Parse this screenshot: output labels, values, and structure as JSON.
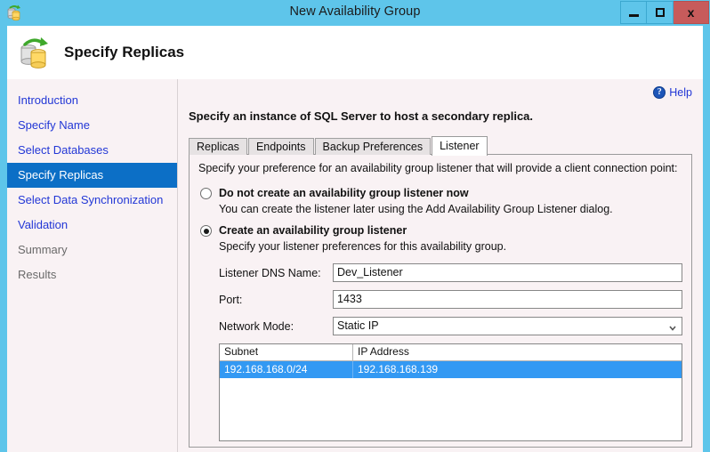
{
  "window": {
    "title": "New Availability Group",
    "icon": "database-sync-icon",
    "buttons": {
      "minimize": "minimize-button",
      "maximize": "maximize-button",
      "close": "x"
    }
  },
  "header": {
    "title": "Specify Replicas",
    "icon": "database-sync-icon"
  },
  "sidebar": {
    "items": [
      {
        "label": "Introduction",
        "state": "link"
      },
      {
        "label": "Specify Name",
        "state": "link"
      },
      {
        "label": "Select Databases",
        "state": "link"
      },
      {
        "label": "Specify Replicas",
        "state": "selected"
      },
      {
        "label": "Select Data Synchronization",
        "state": "link"
      },
      {
        "label": "Validation",
        "state": "link"
      },
      {
        "label": "Summary",
        "state": "disabled"
      },
      {
        "label": "Results",
        "state": "disabled"
      }
    ]
  },
  "content": {
    "help": {
      "label": "Help",
      "icon": "question-mark-icon"
    },
    "instruction": "Specify an instance of SQL Server to host a secondary replica.",
    "tabs": [
      {
        "label": "Replicas",
        "active": false
      },
      {
        "label": "Endpoints",
        "active": false
      },
      {
        "label": "Backup Preferences",
        "active": false
      },
      {
        "label": "Listener",
        "active": true
      }
    ],
    "panel": {
      "description": "Specify your preference for an availability group listener that will provide a client connection point:",
      "options": [
        {
          "label": "Do not create an availability group listener now",
          "sublabel": "You can create the listener later using the Add Availability Group Listener dialog.",
          "selected": false
        },
        {
          "label": "Create an availability group listener",
          "sublabel": "Specify your listener preferences for this availability group.",
          "selected": true
        }
      ],
      "form": {
        "dns_name_label": "Listener DNS Name:",
        "dns_name_value": "Dev_Listener",
        "port_label": "Port:",
        "port_value": "1433",
        "network_mode_label": "Network Mode:",
        "network_mode_value": "Static IP"
      },
      "grid": {
        "columns": [
          "Subnet",
          "IP Address"
        ],
        "rows": [
          {
            "subnet": "192.168.168.0/24",
            "ip": "192.168.168.139",
            "selected": true
          }
        ]
      }
    }
  },
  "colors": {
    "titlebar": "#5ec5ea",
    "close_button": "#c75b5b",
    "sidebar_bg": "#f9f2f4",
    "link": "#2237d6",
    "selected_nav": "#0c6fc6",
    "grid_selection": "#3399f3"
  }
}
